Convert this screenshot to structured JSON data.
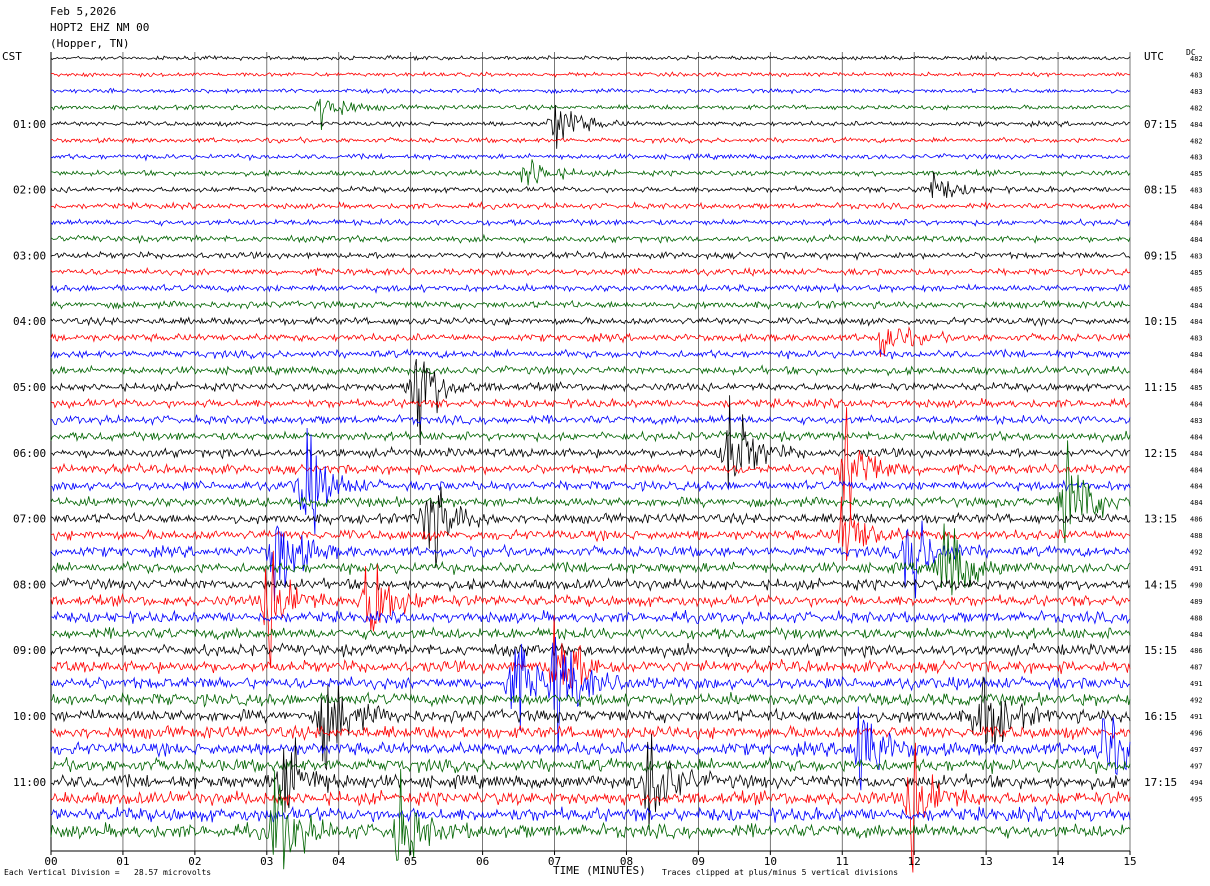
{
  "header": {
    "date": "Feb 5,2026",
    "station": "HOPT2 EHZ NM 00",
    "location": "(Hopper, TN)"
  },
  "left_zone": "CST",
  "right_zone": "UTC",
  "dc_label": "DC",
  "footer": {
    "scale": "Each Vertical Division =   28.57 microvolts",
    "xlabel": "TIME (MINUTES)",
    "clip_note": "Traces clipped at plus/minus 5 vertical divisions"
  },
  "colors": {
    "trace_cycle": [
      "#000000",
      "#ff0000",
      "#0000ff",
      "#006400"
    ],
    "grid": "#555555"
  },
  "chart_data": {
    "type": "line",
    "xlabel": "TIME (MINUTES)",
    "x_ticks": [
      "00",
      "01",
      "02",
      "03",
      "04",
      "05",
      "06",
      "07",
      "08",
      "09",
      "10",
      "11",
      "12",
      "13",
      "14",
      "15"
    ],
    "xlim": [
      0,
      15
    ],
    "traces_per_hour": 4,
    "left_hour_labels": [
      "01:00",
      "02:00",
      "03:00",
      "04:00",
      "05:00",
      "06:00",
      "07:00",
      "08:00",
      "09:00",
      "10:00",
      "11:00"
    ],
    "right_hour_labels": [
      "07:15",
      "08:15",
      "09:15",
      "10:15",
      "11:15",
      "12:15",
      "13:15",
      "14:15",
      "15:15",
      "16:15",
      "17:15"
    ],
    "dc_offsets": [
      "482",
      "483",
      "483",
      "482",
      "484",
      "482",
      "483",
      "485",
      "483",
      "484",
      "484",
      "484",
      "483",
      "485",
      "485",
      "484",
      "484",
      "483",
      "484",
      "484",
      "485",
      "484",
      "483",
      "484",
      "484",
      "484",
      "484",
      "484",
      "486",
      "488",
      "492",
      "491",
      "490",
      "489",
      "488",
      "484",
      "486",
      "487",
      "491",
      "492",
      "491",
      "496",
      "497",
      "497",
      "494",
      "495"
    ],
    "events": [
      {
        "trace": 3,
        "minute": 3.75,
        "amp": 0.35
      },
      {
        "trace": 4,
        "minute": 7.0,
        "amp": 0.5
      },
      {
        "trace": 7,
        "minute": 6.6,
        "amp": 0.35
      },
      {
        "trace": 8,
        "minute": 12.2,
        "amp": 0.3
      },
      {
        "trace": 17,
        "minute": 11.55,
        "amp": 0.4
      },
      {
        "trace": 20,
        "minute": 5.05,
        "amp": 1.0
      },
      {
        "trace": 24,
        "minute": 9.4,
        "amp": 1.0
      },
      {
        "trace": 25,
        "minute": 11.05,
        "amp": 1.0
      },
      {
        "trace": 26,
        "minute": 3.5,
        "amp": 1.0
      },
      {
        "trace": 27,
        "minute": 14.1,
        "amp": 1.0
      },
      {
        "trace": 28,
        "minute": 5.2,
        "amp": 1.0
      },
      {
        "trace": 29,
        "minute": 11.0,
        "amp": 0.7
      },
      {
        "trace": 30,
        "minute": 3.1,
        "amp": 1.0
      },
      {
        "trace": 30,
        "minute": 11.9,
        "amp": 1.0
      },
      {
        "trace": 31,
        "minute": 12.4,
        "amp": 1.0
      },
      {
        "trace": 33,
        "minute": 3.0,
        "amp": 1.0
      },
      {
        "trace": 33,
        "minute": 4.4,
        "amp": 1.0
      },
      {
        "trace": 37,
        "minute": 7.0,
        "amp": 1.0
      },
      {
        "trace": 38,
        "minute": 6.4,
        "amp": 0.8
      },
      {
        "trace": 38,
        "minute": 7.0,
        "amp": 1.0
      },
      {
        "trace": 40,
        "minute": 3.8,
        "amp": 1.0
      },
      {
        "trace": 40,
        "minute": 12.9,
        "amp": 1.0
      },
      {
        "trace": 42,
        "minute": 11.2,
        "amp": 1.0
      },
      {
        "trace": 42,
        "minute": 14.6,
        "amp": 0.7
      },
      {
        "trace": 44,
        "minute": 3.2,
        "amp": 1.0
      },
      {
        "trace": 44,
        "minute": 8.3,
        "amp": 1.0
      },
      {
        "trace": 45,
        "minute": 11.95,
        "amp": 1.0
      },
      {
        "trace": 47,
        "minute": 3.1,
        "amp": 1.0
      },
      {
        "trace": 47,
        "minute": 4.8,
        "amp": 0.8
      }
    ]
  }
}
